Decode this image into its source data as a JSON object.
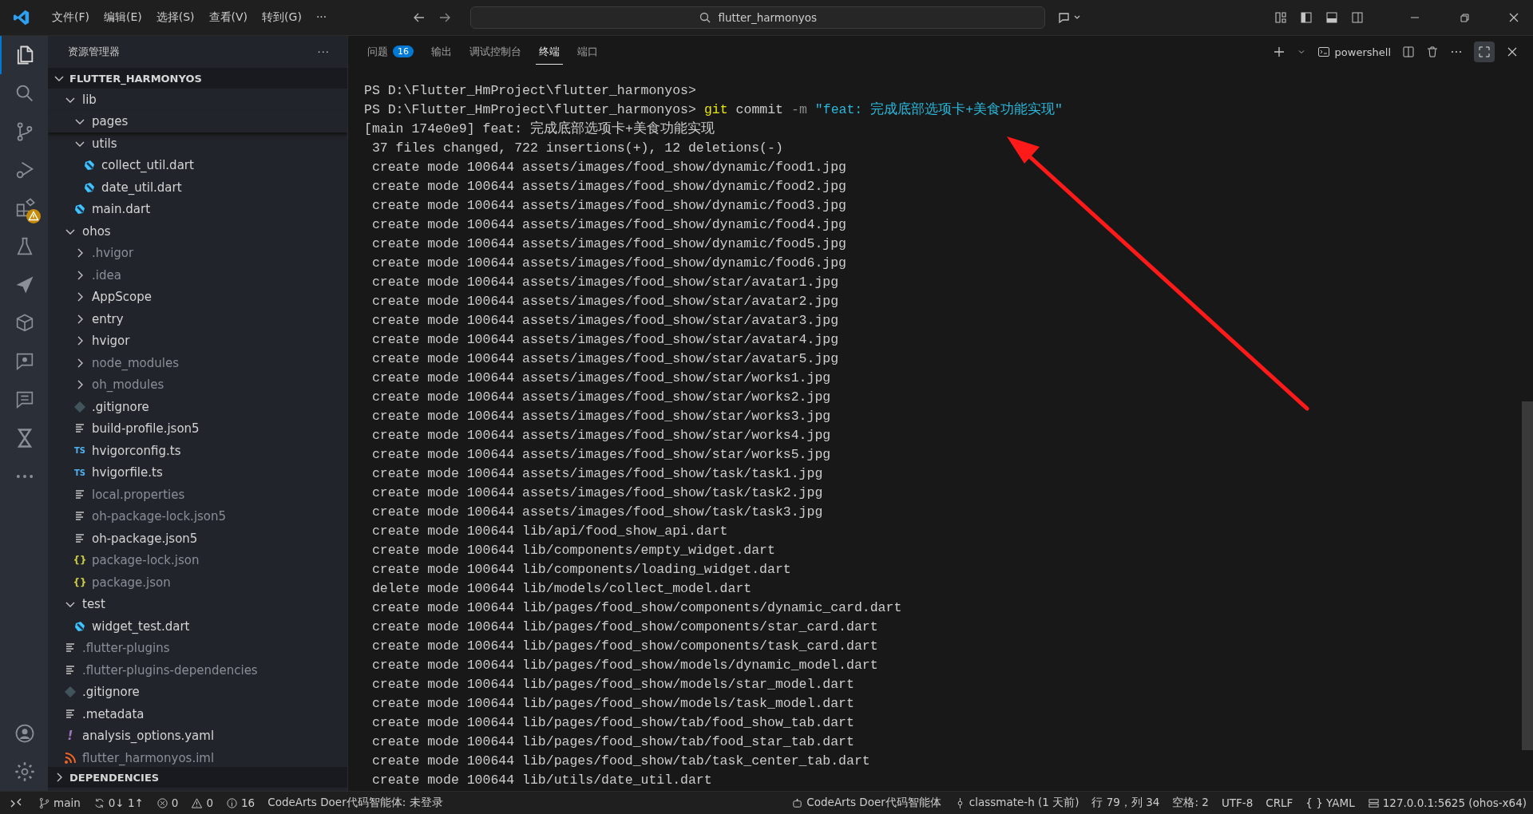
{
  "title_bar": {
    "menus": [
      "文件(F)",
      "编辑(E)",
      "选择(S)",
      "查看(V)",
      "转到(G)",
      "···"
    ],
    "search": {
      "value": "flutter_harmonyos"
    }
  },
  "activity_bar": {
    "items": [
      {
        "kind": "files",
        "selected": true
      },
      {
        "kind": "search",
        "selected": false
      },
      {
        "kind": "source-control",
        "selected": false
      },
      {
        "kind": "debug",
        "selected": false
      },
      {
        "kind": "extensions",
        "selected": false,
        "warning": true
      },
      {
        "kind": "testing",
        "selected": false
      },
      {
        "kind": "send",
        "selected": false
      },
      {
        "kind": "cube",
        "selected": false
      },
      {
        "kind": "bug-send",
        "selected": false
      },
      {
        "kind": "chat-send",
        "selected": false
      },
      {
        "kind": "hourglass",
        "selected": false
      },
      {
        "kind": "more",
        "selected": false
      }
    ]
  },
  "sidebar": {
    "title": "资源管理器",
    "more": "···",
    "root": {
      "label": "FLUTTER_HARMONYOS",
      "expanded": true
    },
    "items": [
      {
        "label": "lib",
        "kind": "folder",
        "expanded": true,
        "dimmed": false,
        "children": [
          {
            "label": "pages",
            "kind": "folder",
            "expanded": true,
            "dimmed": false
          },
          {
            "label": "utils",
            "kind": "folder",
            "expanded": true,
            "dimmed": false,
            "children": [
              {
                "label": "collect_util.dart",
                "kind": "dart",
                "dimmed": false
              },
              {
                "label": "date_util.dart",
                "kind": "dart",
                "dimmed": false
              }
            ]
          },
          {
            "label": "main.dart",
            "kind": "dart",
            "dimmed": false
          }
        ]
      },
      {
        "label": "ohos",
        "kind": "folder",
        "expanded": true,
        "dimmed": false,
        "children": [
          {
            "label": ".hvigor",
            "kind": "folder",
            "expanded": false,
            "dimmed": true
          },
          {
            "label": ".idea",
            "kind": "folder",
            "expanded": false,
            "dimmed": true
          },
          {
            "label": "AppScope",
            "kind": "folder",
            "expanded": false,
            "dimmed": false
          },
          {
            "label": "entry",
            "kind": "folder",
            "expanded": false,
            "dimmed": false
          },
          {
            "label": "hvigor",
            "kind": "folder",
            "expanded": false,
            "dimmed": false
          },
          {
            "label": "node_modules",
            "kind": "folder",
            "expanded": false,
            "dimmed": true
          },
          {
            "label": "oh_modules",
            "kind": "folder",
            "expanded": false,
            "dimmed": true
          },
          {
            "label": ".gitignore",
            "kind": "git",
            "dimmed": false
          },
          {
            "label": "build-profile.json5",
            "kind": "text",
            "dimmed": false
          },
          {
            "label": "hvigorconfig.ts",
            "kind": "ts",
            "glyph": "TS",
            "dimmed": false
          },
          {
            "label": "hvigorfile.ts",
            "kind": "ts",
            "glyph": "TS",
            "dimmed": false
          },
          {
            "label": "local.properties",
            "kind": "text",
            "dimmed": true
          },
          {
            "label": "oh-package-lock.json5",
            "kind": "text",
            "dimmed": true
          },
          {
            "label": "oh-package.json5",
            "kind": "text",
            "dimmed": false
          },
          {
            "label": "package-lock.json",
            "kind": "json",
            "glyph": "{}",
            "dimmed": true
          },
          {
            "label": "package.json",
            "kind": "json",
            "glyph": "{}",
            "dimmed": true
          }
        ]
      },
      {
        "label": "test",
        "kind": "folder",
        "expanded": true,
        "dimmed": false,
        "children": [
          {
            "label": "widget_test.dart",
            "kind": "dart",
            "dimmed": false
          }
        ]
      },
      {
        "label": ".flutter-plugins",
        "kind": "text",
        "dimmed": true
      },
      {
        "label": ".flutter-plugins-dependencies",
        "kind": "text",
        "dimmed": true
      },
      {
        "label": ".gitignore",
        "kind": "git",
        "dimmed": false
      },
      {
        "label": ".metadata",
        "kind": "text",
        "dimmed": false
      },
      {
        "label": "analysis_options.yaml",
        "kind": "yaml",
        "glyph": "!",
        "dimmed": false
      },
      {
        "label": "flutter_harmonyos.iml",
        "kind": "rss",
        "dimmed": true
      }
    ],
    "dependencies": {
      "label": "DEPENDENCIES",
      "expanded": false
    }
  },
  "panel": {
    "tabs": [
      {
        "label": "问题",
        "badge": "16",
        "selected": false
      },
      {
        "label": "输出",
        "selected": false
      },
      {
        "label": "调试控制台",
        "selected": false
      },
      {
        "label": "终端",
        "selected": true
      },
      {
        "label": "端口",
        "selected": false
      }
    ],
    "shell": "powershell",
    "terminal": [
      {
        "kind": "prompt",
        "text": "PS D:\\Flutter_HmProject\\flutter_harmonyos>"
      },
      {
        "kind": "command",
        "prompt": "PS D:\\Flutter_HmProject\\flutter_harmonyos>",
        "program": "git",
        "args": "commit",
        "flag": "-m",
        "message": "\"feat: 完成底部选项卡+美食功能实现\""
      },
      {
        "kind": "output",
        "text": "[main 174e0e9] feat: 完成底部选项卡+美食功能实现"
      },
      {
        "kind": "output",
        "text": " 37 files changed, 722 insertions(+), 12 deletions(-)"
      },
      {
        "kind": "output",
        "text": " create mode 100644 assets/images/food_show/dynamic/food1.jpg"
      },
      {
        "kind": "output",
        "text": " create mode 100644 assets/images/food_show/dynamic/food2.jpg"
      },
      {
        "kind": "output",
        "text": " create mode 100644 assets/images/food_show/dynamic/food3.jpg"
      },
      {
        "kind": "output",
        "text": " create mode 100644 assets/images/food_show/dynamic/food4.jpg"
      },
      {
        "kind": "output",
        "text": " create mode 100644 assets/images/food_show/dynamic/food5.jpg"
      },
      {
        "kind": "output",
        "text": " create mode 100644 assets/images/food_show/dynamic/food6.jpg"
      },
      {
        "kind": "output",
        "text": " create mode 100644 assets/images/food_show/star/avatar1.jpg"
      },
      {
        "kind": "output",
        "text": " create mode 100644 assets/images/food_show/star/avatar2.jpg"
      },
      {
        "kind": "output",
        "text": " create mode 100644 assets/images/food_show/star/avatar3.jpg"
      },
      {
        "kind": "output",
        "text": " create mode 100644 assets/images/food_show/star/avatar4.jpg"
      },
      {
        "kind": "output",
        "text": " create mode 100644 assets/images/food_show/star/avatar5.jpg"
      },
      {
        "kind": "output",
        "text": " create mode 100644 assets/images/food_show/star/works1.jpg"
      },
      {
        "kind": "output",
        "text": " create mode 100644 assets/images/food_show/star/works2.jpg"
      },
      {
        "kind": "output",
        "text": " create mode 100644 assets/images/food_show/star/works3.jpg"
      },
      {
        "kind": "output",
        "text": " create mode 100644 assets/images/food_show/star/works4.jpg"
      },
      {
        "kind": "output",
        "text": " create mode 100644 assets/images/food_show/star/works5.jpg"
      },
      {
        "kind": "output",
        "text": " create mode 100644 assets/images/food_show/task/task1.jpg"
      },
      {
        "kind": "output",
        "text": " create mode 100644 assets/images/food_show/task/task2.jpg"
      },
      {
        "kind": "output",
        "text": " create mode 100644 assets/images/food_show/task/task3.jpg"
      },
      {
        "kind": "output",
        "text": " create mode 100644 lib/api/food_show_api.dart"
      },
      {
        "kind": "output",
        "text": " create mode 100644 lib/components/empty_widget.dart"
      },
      {
        "kind": "output",
        "text": " create mode 100644 lib/components/loading_widget.dart"
      },
      {
        "kind": "output",
        "text": " delete mode 100644 lib/models/collect_model.dart"
      },
      {
        "kind": "output",
        "text": " create mode 100644 lib/pages/food_show/components/dynamic_card.dart"
      },
      {
        "kind": "output",
        "text": " create mode 100644 lib/pages/food_show/components/star_card.dart"
      },
      {
        "kind": "output",
        "text": " create mode 100644 lib/pages/food_show/components/task_card.dart"
      },
      {
        "kind": "output",
        "text": " create mode 100644 lib/pages/food_show/models/dynamic_model.dart"
      },
      {
        "kind": "output",
        "text": " create mode 100644 lib/pages/food_show/models/star_model.dart"
      },
      {
        "kind": "output",
        "text": " create mode 100644 lib/pages/food_show/models/task_model.dart"
      },
      {
        "kind": "output",
        "text": " create mode 100644 lib/pages/food_show/tab/food_show_tab.dart"
      },
      {
        "kind": "output",
        "text": " create mode 100644 lib/pages/food_show/tab/food_star_tab.dart"
      },
      {
        "kind": "output",
        "text": " create mode 100644 lib/pages/food_show/tab/task_center_tab.dart"
      },
      {
        "kind": "output",
        "text": " create mode 100644 lib/utils/date_util.dart"
      }
    ]
  },
  "status_bar": {
    "left": [
      {
        "kind": "branch",
        "text": "main"
      },
      {
        "kind": "sync",
        "text": "0↓ 1↑"
      },
      {
        "kind": "errors",
        "text": "0"
      },
      {
        "kind": "warnings",
        "text": "0"
      },
      {
        "kind": "info",
        "text": "16"
      },
      {
        "kind": "plain",
        "text": "CodeArts Doer代码智能体: 未登录"
      }
    ],
    "right": [
      {
        "kind": "agent",
        "text": "CodeArts Doer代码智能体"
      },
      {
        "kind": "blame",
        "text": "classmate-h (1 天前)"
      },
      {
        "kind": "plain",
        "text": "行 79，列 34"
      },
      {
        "kind": "plain",
        "text": "空格: 2"
      },
      {
        "kind": "plain",
        "text": "UTF-8"
      },
      {
        "kind": "plain",
        "text": "CRLF"
      },
      {
        "kind": "plain",
        "text": "{ } YAML"
      },
      {
        "kind": "server",
        "text": "127.0.0.1:5625 (ohos-x64)"
      }
    ]
  },
  "annotation": {
    "kind": "arrow"
  }
}
